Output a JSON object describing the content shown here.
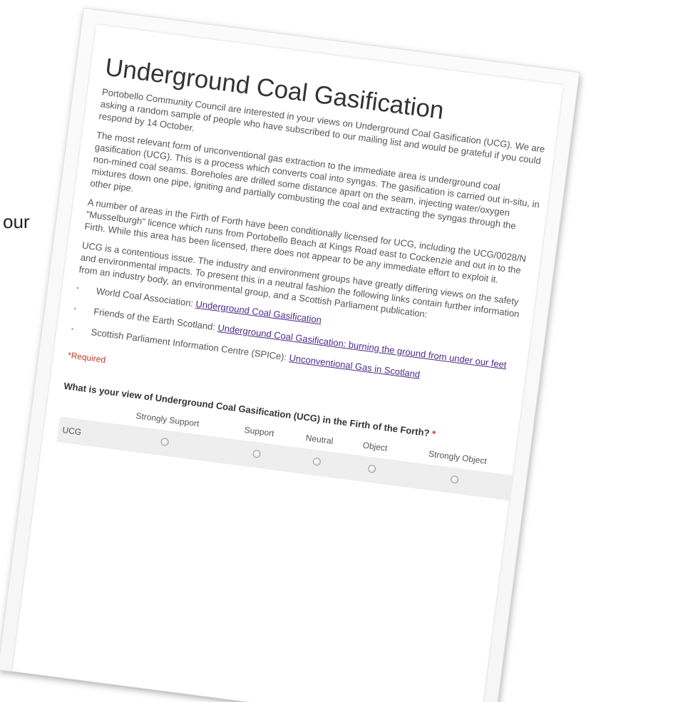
{
  "background": {
    "fragment_text": "our"
  },
  "form": {
    "title": "Underground Coal Gasification",
    "paragraphs": [
      "Portobello Community Council are interested in your views on Underground Coal Gasification (UCG). We are asking a random sample of people who have subscribed to our mailing list and would be grateful if you could respond by 14 October.",
      "The most relevant form of unconventional gas extraction to the immediate area is underground coal gasification (UCG). This is a process which converts coal into syngas. The gasification is carried out in-situ, in non-mined coal seams. Boreholes are drilled some distance apart on the seam, injecting water/oxygen mixtures down one pipe, igniting and partially combusting the coal and extracting the syngas through the other pipe.",
      "A number of areas in the Firth of Forth have been conditionally licensed for UCG, including the UCG/0028/N \"Musselburgh\" licence which runs from Portobello Beach at Kings Road east to Cockenzie and out in to the Firth. While this area has been licensed, there does not appear to be any immediate effort to exploit it.",
      "UCG is a contentious issue. The industry and environment groups have greatly differing views on the safety and environmental impacts. To present this in a neutral fashion the following links contain further information from an industry body, an environmental group, and a Scottish Parliament publication:"
    ],
    "links": [
      {
        "prefix": "World Coal Association: ",
        "link_text": "Underground Coal Gasification"
      },
      {
        "prefix": "Friends of the Earth Scotland: ",
        "link_text": "Underground Coal Gasification: burning the ground from under our feet"
      },
      {
        "prefix": "Scottish Parliament Information Centre (SPICe): ",
        "link_text": "Unconventional Gas in Scotland"
      }
    ],
    "bullet_glyph": "•",
    "required_note": "*Required",
    "question": {
      "text": "What is your view of Underground Coal Gasification (UCG) in the Firth of the Forth?",
      "required_mark": " *",
      "columns": [
        "Strongly Support",
        "Support",
        "Neutral",
        "Object",
        "Strongly Object"
      ],
      "row_label": "UCG"
    }
  }
}
